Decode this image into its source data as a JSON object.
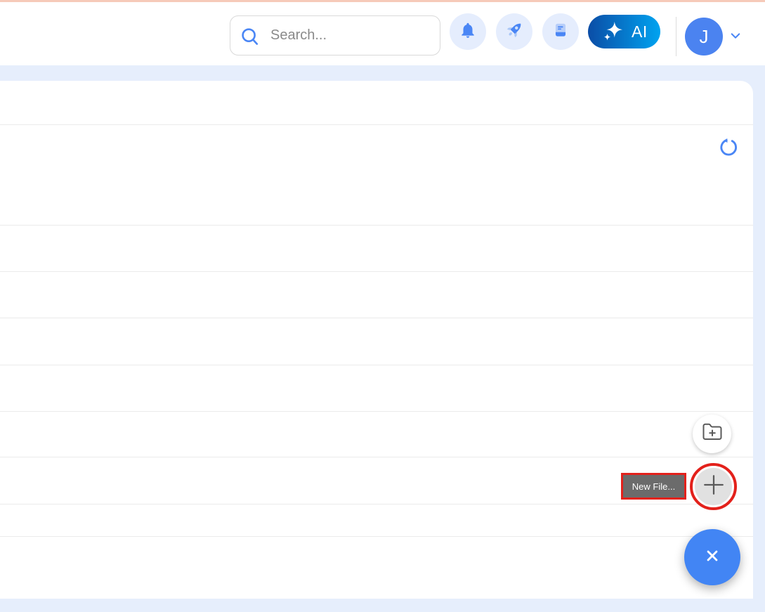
{
  "app": {
    "top_accent_color": "#f6cab9",
    "workspace_bg": "#e6eefc",
    "accent_blue": "#4a86f5",
    "annotation_color": "#e3211b"
  },
  "header": {
    "search": {
      "placeholder": "Search...",
      "value": "",
      "icon": "search-icon"
    },
    "actions": {
      "notifications": {
        "icon": "bell-icon"
      },
      "launcher": {
        "icon": "rocket-icon"
      },
      "guide": {
        "icon": "notebook-icon"
      },
      "ai_button": {
        "label": "AI",
        "icon": "sparkles-icon",
        "gradient_start": "#0b4da6",
        "gradient_end": "#00a3f0"
      }
    },
    "user_menu": {
      "initial": "J",
      "avatar_color": "#4b83f0",
      "chevron_icon": "chevron-down-icon"
    }
  },
  "content": {
    "toolbar": {
      "refresh_icon": "refresh-icon"
    },
    "file_list": {
      "visible_rows": 9,
      "rows_empty": true
    },
    "fab_menu": {
      "open": true,
      "tooltip_label": "New File...",
      "options": [
        {
          "name": "new-folder",
          "icon": "folder-plus-icon"
        },
        {
          "name": "new-file",
          "icon": "plus-icon",
          "highlighted": true
        }
      ],
      "close_button": {
        "icon": "close-icon",
        "color": "#4285f4"
      }
    }
  }
}
